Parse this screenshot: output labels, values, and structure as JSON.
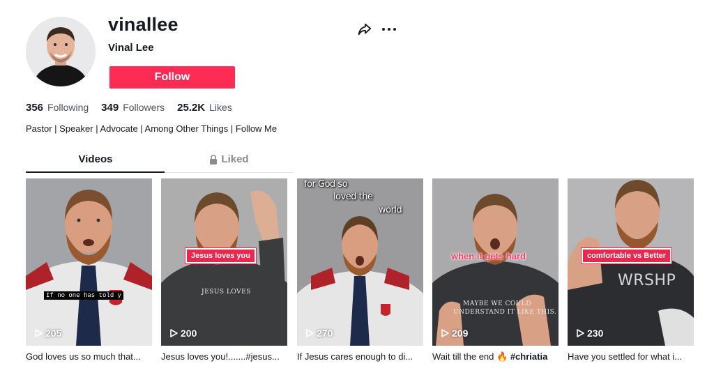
{
  "profile": {
    "username": "vinallee",
    "nickname": "Vinal Lee",
    "follow_label": "Follow",
    "bio": "Pastor | Speaker | Advocate | Among Other Things | Follow Me",
    "share_icon": "share-arrow-icon",
    "more_icon": "ellipsis-icon"
  },
  "stats": {
    "following_count": "356",
    "following_label": "Following",
    "followers_count": "349",
    "followers_label": "Followers",
    "likes_count": "25.2K",
    "likes_label": "Likes"
  },
  "tabs": {
    "videos_label": "Videos",
    "liked_label": "Liked",
    "liked_icon": "lock-icon"
  },
  "videos": [
    {
      "views": "205",
      "caption": "God loves us so much that...",
      "overlay_text": "If no one has told y"
    },
    {
      "views": "200",
      "caption": "Jesus loves you!.......#jesus...",
      "overlay_text": "Jesus loves you",
      "shirt_text": "JESUS LOVES"
    },
    {
      "views": "270",
      "caption": "If Jesus cares enough to di...",
      "overlay_line1": "for God so",
      "overlay_line2": "loved the",
      "overlay_line3": "world"
    },
    {
      "views": "209",
      "caption_prefix": "Wait till the end 🔥",
      "caption_hashtag": "#chriatia",
      "overlay_text": "when it gets hard",
      "shirt_line1": "MAYBE WE COULD",
      "shirt_line2": "UNDERSTAND IT LIKE THIS."
    },
    {
      "views": "230",
      "caption": "Have you settled for what i...",
      "overlay_text": "comfortable vs Better",
      "shirt_text": "WRSHP"
    }
  ],
  "colors": {
    "accent": "#fe2c55",
    "text_primary": "#161823",
    "text_secondary": "#8a8b91"
  }
}
